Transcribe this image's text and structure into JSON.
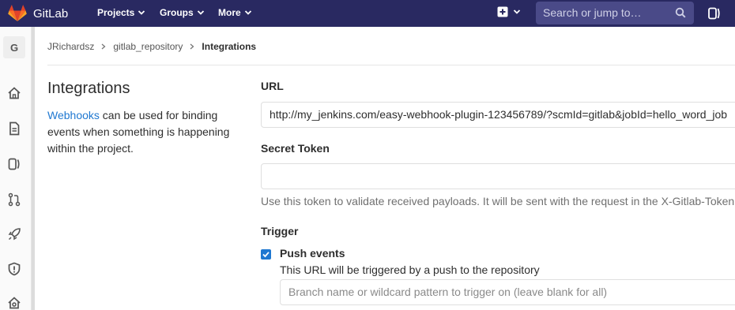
{
  "navbar": {
    "brand": "GitLab",
    "items": [
      {
        "label": "Projects"
      },
      {
        "label": "Groups"
      },
      {
        "label": "More"
      }
    ],
    "search_placeholder": "Search or jump to…",
    "icons": {
      "logo": "gitlab-tanuki-icon",
      "plus": "plus-square-icon",
      "search": "search-icon",
      "merge_requests": "merge-requests-icon"
    },
    "colors": {
      "background": "#292961",
      "search_bg": "#4a4a88"
    }
  },
  "sidebar": {
    "project_initial": "G",
    "icons": [
      "home-icon",
      "repository-icon",
      "issues-icon",
      "merge-request-icon",
      "rocket-icon",
      "security-icon",
      "operations-icon"
    ]
  },
  "breadcrumb": {
    "items": [
      "JRichardsz",
      "gitlab_repository",
      "Integrations"
    ]
  },
  "section": {
    "title": "Integrations",
    "link_text": "Webhooks",
    "desc_rest": " can be used for binding events when something is happening within the project."
  },
  "form": {
    "url_label": "URL",
    "url_value": "http://my_jenkins.com/easy-webhook-plugin-123456789/?scmId=gitlab&jobId=hello_word_job",
    "token_label": "Secret Token",
    "token_value": "",
    "token_help": "Use this token to validate received payloads. It will be sent with the request in the X-Gitlab-Token H",
    "trigger_label": "Trigger",
    "push_events_label": "Push events",
    "push_events_checked": true,
    "push_events_help": "This URL will be triggered by a push to the repository",
    "branch_placeholder": "Branch name or wildcard pattern to trigger on (leave blank for all)"
  },
  "colors": {
    "link": "#1f78d1",
    "checkbox": "#1f78d1"
  }
}
